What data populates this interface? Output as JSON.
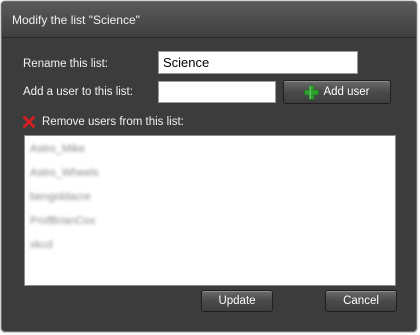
{
  "dialog": {
    "title": "Modify the list \"Science\""
  },
  "rename": {
    "label": "Rename this list:",
    "value": "Science"
  },
  "add_user": {
    "label": "Add a user to this list:",
    "value": "",
    "button_label": "Add user"
  },
  "remove": {
    "label": "Remove users from this list:"
  },
  "users": [
    "Astro_Mike",
    "Astro_Wheels",
    "bengoldacre",
    "ProfBrianCox",
    "xkcd"
  ],
  "footer": {
    "update_label": "Update",
    "cancel_label": "Cancel"
  },
  "colors": {
    "background": "#3c3c3c",
    "add_icon": "#2fa02f",
    "remove_icon": "#d42020"
  },
  "icons": {
    "add": "plus-icon",
    "remove": "x-icon"
  }
}
